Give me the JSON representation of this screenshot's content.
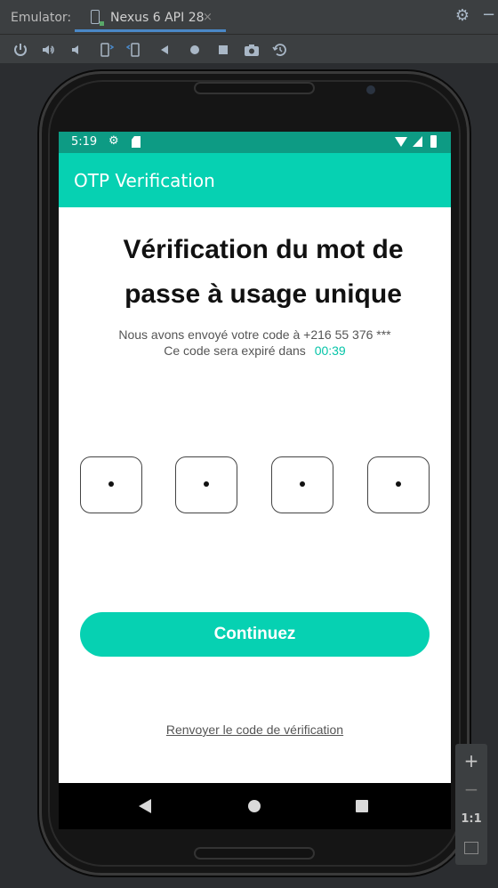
{
  "ide": {
    "label": "Emulator:",
    "tab_title": "Nexus 6 API 28",
    "tab_close": "×",
    "gear": "⚙",
    "minimize": "−",
    "toolbar_icons": [
      "power-icon",
      "volume-up-icon",
      "volume-down-icon",
      "rotate-left-icon",
      "rotate-right-icon",
      "back-icon",
      "home-icon",
      "overview-icon",
      "screenshot-icon",
      "snapshot-icon"
    ]
  },
  "statusbar": {
    "time": "5:19",
    "gear": "⚙"
  },
  "appbar": {
    "title": "OTP Verification"
  },
  "main": {
    "heading": "Vérification du mot de passe à usage unique",
    "info_line1": "Nous avons envoyé votre code à +216 55 376 ***",
    "info_line2_prefix": "Ce code sera expiré dans",
    "timer": "00:39",
    "otp_boxes": [
      "",
      "",
      "",
      ""
    ],
    "continue_label": "Continuez",
    "resend_label": "Renvoyer le code de vérification"
  },
  "zoom": {
    "plus": "+",
    "minus": "−",
    "one_to_one": "1:1"
  },
  "colors": {
    "accent": "#06d1b2",
    "status_bar": "#0d9b84",
    "timer": "#06c4a8"
  }
}
